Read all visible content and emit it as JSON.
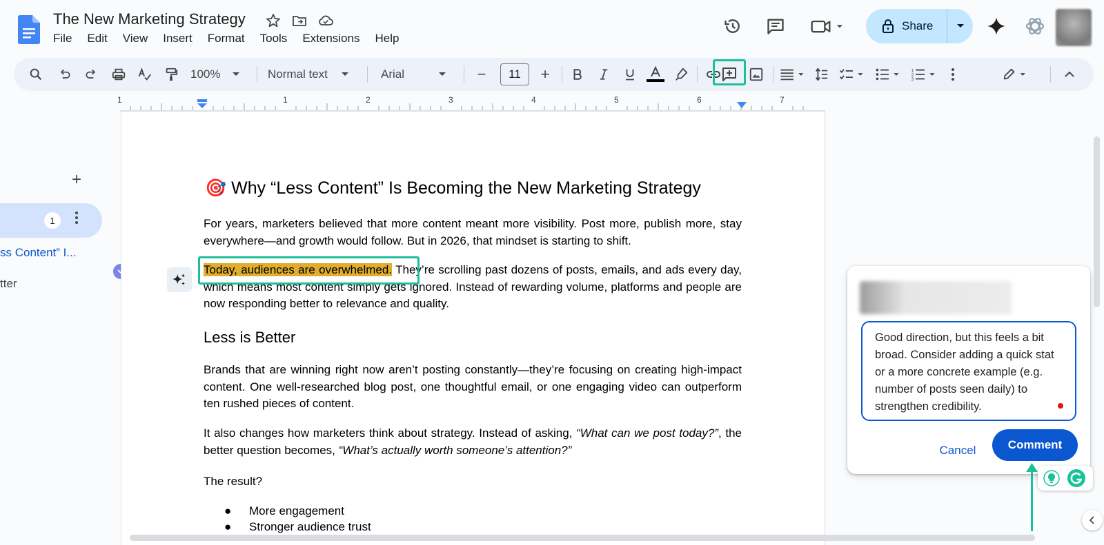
{
  "app": {
    "doc_title": "The New Marketing Strategy",
    "menu": [
      "File",
      "Edit",
      "View",
      "Insert",
      "Format",
      "Tools",
      "Extensions",
      "Help"
    ],
    "share_label": "Share"
  },
  "toolbar": {
    "zoom": "100%",
    "style": "Normal text",
    "font": "Arial",
    "font_size": "11",
    "minus": "−",
    "plus": "+"
  },
  "ruler": {
    "labels": [
      "1",
      "1",
      "2",
      "3",
      "4",
      "5",
      "6",
      "7"
    ]
  },
  "outline": {
    "add": "+",
    "badge": "1",
    "item1": "ss Content” I...",
    "item2": "tter"
  },
  "document": {
    "heading_emoji": "🎯",
    "heading": "Why “Less Content” Is Becoming the New Marketing Strategy",
    "p1": "For years, marketers believed that more content meant more visibility. Post more, publish more, stay everywhere—and growth would follow. But in 2026, that mindset is starting to shift.",
    "p2_highlight": "Today, audiences are overwhelmed.",
    "p2_rest": " They’re scrolling past dozens of posts, emails, and ads every day, which means most content simply gets ignored. Instead of rewarding volume, platforms and people are now responding better to relevance and quality.",
    "h2": "Less is Better",
    "p3": "Brands that are winning right now aren’t posting constantly—they’re focusing on creating high-impact content. One well-researched blog post, one thoughtful email, or one engaging video can outperform ten rushed pieces of content.",
    "p4_a": "It also changes how marketers think about strategy. Instead of asking, ",
    "p4_q1": "“What can we post today?”",
    "p4_b": ", the better question becomes, ",
    "p4_q2": "“What’s actually worth someone’s attention?”",
    "p5": "The result?",
    "bullets": [
      "More engagement",
      "Stronger audience trust"
    ],
    "bullet_char": "●"
  },
  "comment": {
    "text": "Good direction, but this feels a bit broad. Consider adding a quick stat or a more concrete example (e.g. number of posts seen daily) to strengthen credibility.",
    "cancel": "Cancel",
    "submit": "Comment"
  },
  "colors": {
    "accent": "#0b57d0",
    "highlight": "#e0ae2f",
    "annotation": "#1dbf98"
  }
}
